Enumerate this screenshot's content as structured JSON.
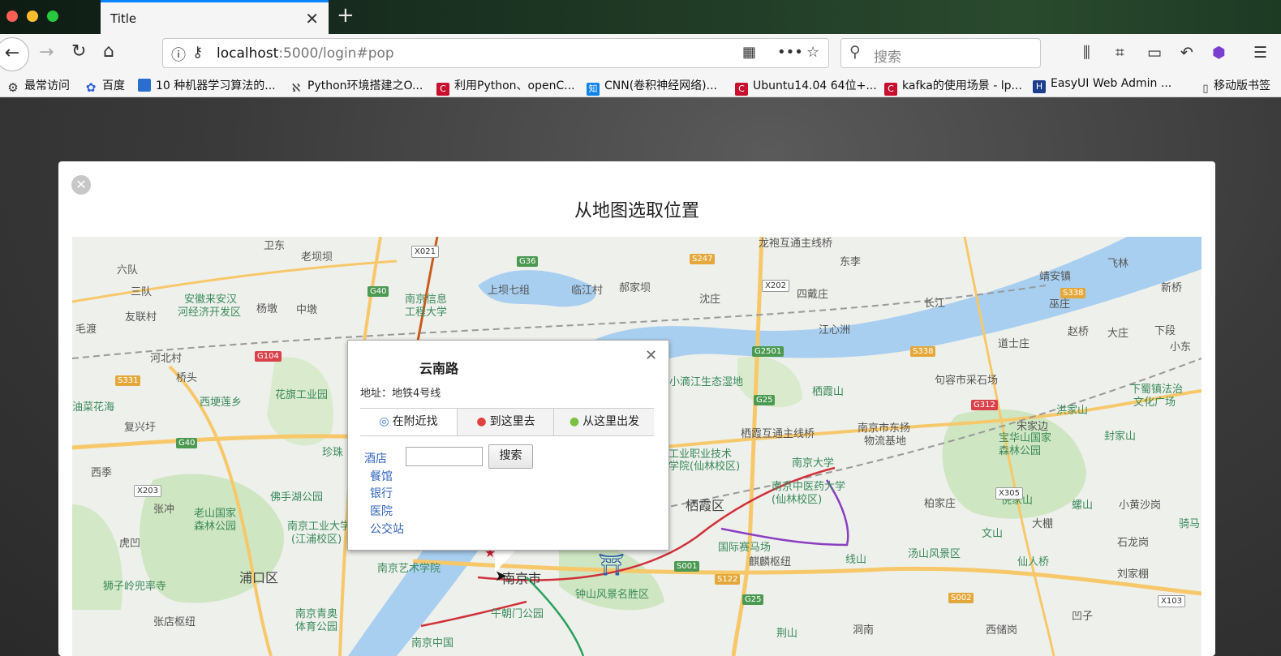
{
  "browser": {
    "tab_title": "Title",
    "tab_close": "✕",
    "new_tab": "+",
    "url_host": "localhost",
    "url_rest": ":5000/login#pop",
    "search_placeholder": "搜索"
  },
  "bookmarks": [
    {
      "label": "最常访问",
      "icon": "gear-icon"
    },
    {
      "label": "百度",
      "icon": "baidu-paw-icon"
    },
    {
      "label": "10 种机器学习算法的...",
      "icon": "site-icon"
    },
    {
      "label": "Python环境搭建之O...",
      "icon": "site-icon"
    },
    {
      "label": "利用Python、openC...",
      "icon": "csdn-icon"
    },
    {
      "label": "CNN(卷积神经网络)...",
      "icon": "zhihu-icon"
    },
    {
      "label": "Ubuntu14.04 64位+...",
      "icon": "csdn-icon"
    },
    {
      "label": "kafka的使用场景 - lp...",
      "icon": "csdn-icon"
    },
    {
      "label": "EasyUI Web Admin ...",
      "icon": "site-icon"
    },
    {
      "label": "移动版书签",
      "icon": "mobile-icon"
    }
  ],
  "modal": {
    "close": "✕",
    "title": "从地图选取位置"
  },
  "popup": {
    "title": "云南路",
    "close": "✕",
    "address": "地址：地铁4号线",
    "tabs": [
      "在附近找",
      "到这里去",
      "从这里出发"
    ],
    "categories": [
      "酒店",
      "餐馆",
      "银行",
      "医院",
      "公交站"
    ],
    "search_button": "搜索",
    "search_value": ""
  },
  "map": {
    "labels": [
      "六队",
      "三队",
      "友联村",
      "毛渡",
      "河北村",
      "桥头",
      "安徽来安汉",
      "河经济开发区",
      "杨墩",
      "中墩",
      "老坝坝",
      "南京信息",
      "工程大学",
      "上坝七组",
      "临江村",
      "郝家坝",
      "沈庄",
      "四戴庄",
      "东李",
      "靖安镇",
      "飞林",
      "新桥",
      "巫庄",
      "赵桥",
      "大庄",
      "下段",
      "长江",
      "江心洲",
      "道士庄",
      "小东",
      "花旗工业园",
      "西埂莲乡",
      "珍珠",
      "佛手湖公园",
      "老山国家",
      "森林公园",
      "南京工业大学",
      "(江浦校区)",
      "狮子岭兜率寺",
      "浦口区",
      "张店枢纽",
      "南京青奥",
      "体育公园",
      "南京艺术学院",
      "南京市",
      "钟山风景名胜区",
      "午朝门公园",
      "南京中国",
      "小滴江生态湿地",
      "栖霞山",
      "栖霞互通主线桥",
      "南京市东扬",
      "物流基地",
      "南京大学",
      "南京中医药大学",
      "(仙林校区)",
      "工业职业技术",
      "学院(仙林校区)",
      "栖霞区",
      "国际赛马场",
      "麒麟枢纽",
      "线山",
      "汤山风景区",
      "仙人桥",
      "倪家山",
      "文山",
      "宝华山国家",
      "森林公园",
      "句容市采石场",
      "洪家山",
      "封家山",
      "下蜀镇法治",
      "文化广场",
      "宋家边",
      "螺山",
      "骑马",
      "小黄沙岗",
      "石龙岗",
      "刘家棚",
      "大棚",
      "柏家庄",
      "凹子",
      "西储岗",
      "洞南",
      "荆山",
      "西季",
      "张冲",
      "虎凹",
      "龙袍互通主线桥",
      "油菜花海",
      "复兴圩",
      "卫东"
    ],
    "shields": [
      "X021",
      "G36",
      "S247",
      "X202",
      "G40",
      "G104",
      "S331",
      "G2501",
      "S338",
      "G25",
      "G312",
      "G40",
      "X203",
      "X305",
      "S001",
      "S122",
      "G25",
      "S002",
      "X103",
      "S338"
    ]
  }
}
